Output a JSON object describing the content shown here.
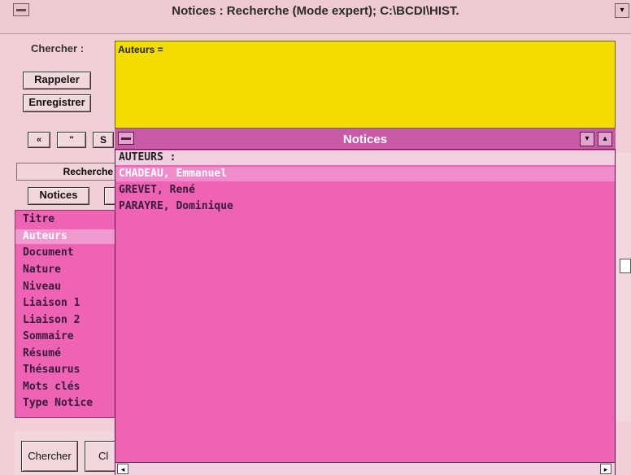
{
  "window": {
    "title": "Notices : Recherche (Mode expert); C:\\BCDI\\HIST.",
    "system_menu_icon": "minus-bar-icon",
    "scroll_arrow_icon": "chevron-down-icon"
  },
  "search": {
    "label": "Chercher :",
    "rappeler_label": "Rappeler",
    "enregistrer_label": "Enregistrer",
    "nav_buttons": [
      "«",
      "\"",
      "S"
    ],
    "query_text": "Auteurs ="
  },
  "recherche": {
    "tab_label": "Recherche",
    "notices_button": "Notices"
  },
  "fields": {
    "items": [
      "Titre",
      "Auteurs",
      "Document",
      "Nature",
      "Niveau",
      "Liaison 1",
      "Liaison 2",
      "Sommaire",
      "Résumé",
      "Thésaurus",
      "Mots clés",
      "Type Notice"
    ],
    "selected": "Auteurs"
  },
  "bottom": {
    "chercher_label": "Chercher",
    "cl_label": "Cl"
  },
  "notices_window": {
    "title": "Notices",
    "header": "AUTEURS :",
    "rows": [
      "CHADEAU, Emmanuel",
      "GREVET, René",
      "PARAYRE, Dominique"
    ],
    "selected_row": "CHADEAU, Emmanuel",
    "down_icon": "▾",
    "up_icon": "▴",
    "hscroll_left": "◂",
    "hscroll_right": "▸"
  },
  "colors": {
    "background": "#f2cfd6",
    "query_box": "#f3dc00",
    "list_pink": "#ee63b4",
    "child_title": "#c85aa8"
  }
}
